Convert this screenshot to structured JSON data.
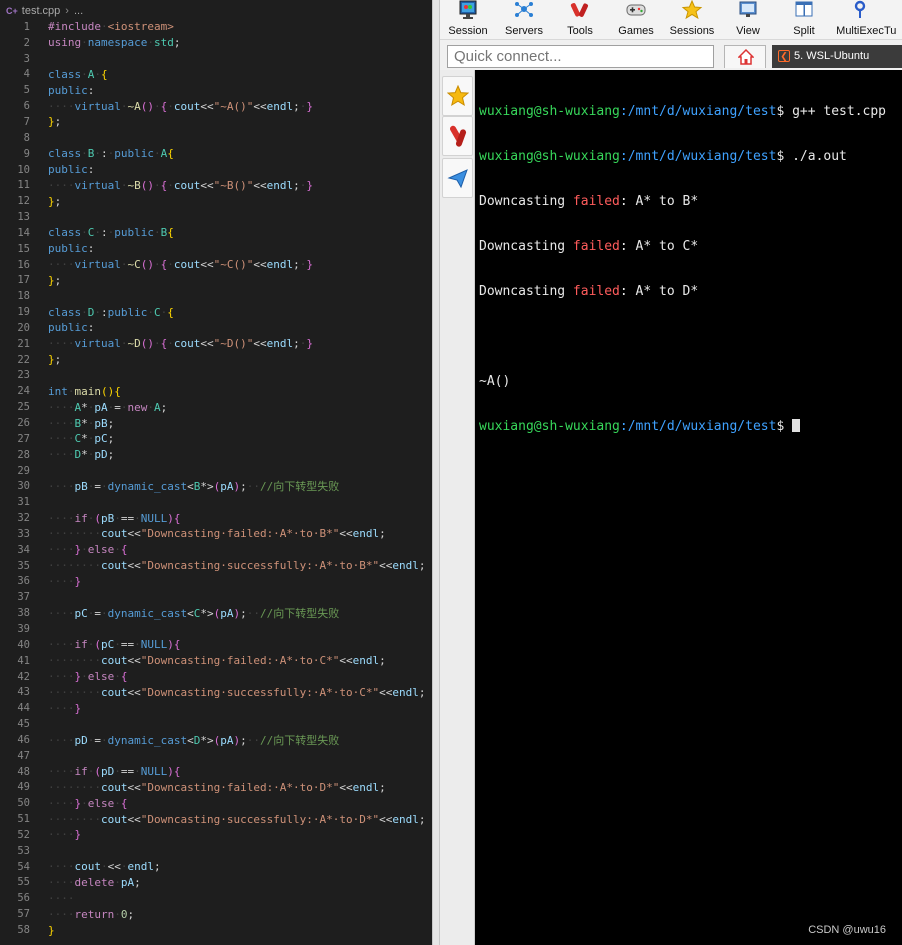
{
  "editor": {
    "breadcrumb": {
      "file_icon": "C+",
      "file": "test.cpp",
      "rest": "..."
    },
    "lines": [
      {
        "n": "1",
        "html": "<span class='pp'>#include</span><span class='ws'>·</span><span class='st'>&lt;iostream&gt;</span>"
      },
      {
        "n": "2",
        "html": "<span class='kw2'>using</span><span class='ws'>·</span><span class='kw'>namespace</span><span class='ws'>·</span><span class='ty'>std</span>;"
      },
      {
        "n": "3",
        "html": ""
      },
      {
        "n": "4",
        "html": "<span class='kw'>class</span><span class='ws'>·</span><span class='ty'>A</span><span class='ws'>·</span><span class='br'>{</span>"
      },
      {
        "n": "5",
        "html": "<span class='kw'>public</span>:"
      },
      {
        "n": "6",
        "html": "<span class='ws'>····</span><span class='kw'>virtual</span><span class='ws'>·</span><span class='fn'>~A</span><span class='br2'>()</span><span class='ws'>·</span><span class='br2'>{</span><span class='ws'>·</span><span class='va'>cout</span>&lt;&lt;<span class='st'>\"~A()\"</span>&lt;&lt;<span class='va'>endl</span>;<span class='ws'>·</span><span class='br2'>}</span>"
      },
      {
        "n": "7",
        "html": "<span class='br'>}</span>;"
      },
      {
        "n": "8",
        "html": ""
      },
      {
        "n": "9",
        "html": "<span class='kw'>class</span><span class='ws'>·</span><span class='ty'>B</span><span class='ws'>·</span>:<span class='ws'>·</span><span class='kw'>public</span><span class='ws'>·</span><span class='ty'>A</span><span class='br'>{</span>"
      },
      {
        "n": "10",
        "html": "<span class='kw'>public</span>:"
      },
      {
        "n": "11",
        "html": "<span class='ws'>····</span><span class='kw'>virtual</span><span class='ws'>·</span><span class='fn'>~B</span><span class='br2'>()</span><span class='ws'>·</span><span class='br2'>{</span><span class='ws'>·</span><span class='va'>cout</span>&lt;&lt;<span class='st'>\"~B()\"</span>&lt;&lt;<span class='va'>endl</span>;<span class='ws'>·</span><span class='br2'>}</span>"
      },
      {
        "n": "12",
        "html": "<span class='br'>}</span>;"
      },
      {
        "n": "13",
        "html": ""
      },
      {
        "n": "14",
        "html": "<span class='kw'>class</span><span class='ws'>·</span><span class='ty'>C</span><span class='ws'>·</span>:<span class='ws'>·</span><span class='kw'>public</span><span class='ws'>·</span><span class='ty'>B</span><span class='br'>{</span>"
      },
      {
        "n": "15",
        "html": "<span class='kw'>public</span>:"
      },
      {
        "n": "16",
        "html": "<span class='ws'>····</span><span class='kw'>virtual</span><span class='ws'>·</span><span class='fn'>~C</span><span class='br2'>()</span><span class='ws'>·</span><span class='br2'>{</span><span class='ws'>·</span><span class='va'>cout</span>&lt;&lt;<span class='st'>\"~C()\"</span>&lt;&lt;<span class='va'>endl</span>;<span class='ws'>·</span><span class='br2'>}</span>"
      },
      {
        "n": "17",
        "html": "<span class='br'>}</span>;"
      },
      {
        "n": "18",
        "html": ""
      },
      {
        "n": "19",
        "html": "<span class='kw'>class</span><span class='ws'>·</span><span class='ty'>D</span><span class='ws'>·</span>:<span class='kw'>public</span><span class='ws'>·</span><span class='ty'>C</span><span class='ws'>·</span><span class='br'>{</span>"
      },
      {
        "n": "20",
        "html": "<span class='kw'>public</span>:"
      },
      {
        "n": "21",
        "html": "<span class='ws'>····</span><span class='kw'>virtual</span><span class='ws'>·</span><span class='fn'>~D</span><span class='br2'>()</span><span class='ws'>·</span><span class='br2'>{</span><span class='ws'>·</span><span class='va'>cout</span>&lt;&lt;<span class='st'>\"~D()\"</span>&lt;&lt;<span class='va'>endl</span>;<span class='ws'>·</span><span class='br2'>}</span>"
      },
      {
        "n": "22",
        "html": "<span class='br'>}</span>;"
      },
      {
        "n": "23",
        "html": ""
      },
      {
        "n": "24",
        "html": "<span class='kw'>int</span><span class='ws'>·</span><span class='fn'>main</span><span class='br'>(){</span>"
      },
      {
        "n": "25",
        "html": "<span class='ws'>····</span><span class='ty'>A</span>*<span class='ws'>·</span><span class='va'>pA</span><span class='ws'>·</span>=<span class='ws'>·</span><span class='kw2'>new</span><span class='ws'>·</span><span class='ty'>A</span>;"
      },
      {
        "n": "26",
        "html": "<span class='ws'>····</span><span class='ty'>B</span>*<span class='ws'>·</span><span class='va'>pB</span>;"
      },
      {
        "n": "27",
        "html": "<span class='ws'>····</span><span class='ty'>C</span>*<span class='ws'>·</span><span class='va'>pC</span>;"
      },
      {
        "n": "28",
        "html": "<span class='ws'>····</span><span class='ty'>D</span>*<span class='ws'>·</span><span class='va'>pD</span>;"
      },
      {
        "n": "29",
        "html": ""
      },
      {
        "n": "30",
        "html": "<span class='ws'>····</span><span class='va'>pB</span><span class='ws'>·</span>=<span class='ws'>·</span><span class='kw'>dynamic_cast</span>&lt;<span class='ty'>B</span>*&gt;<span class='br2'>(</span><span class='va'>pA</span><span class='br2'>)</span>;<span class='ws'>··</span><span class='cm'>//向下转型失败</span>"
      },
      {
        "n": "31",
        "html": ""
      },
      {
        "n": "32",
        "html": "<span class='ws'>····</span><span class='kw2'>if</span><span class='ws'>·</span><span class='br2'>(</span><span class='va'>pB</span><span class='ws'>·</span>==<span class='ws'>·</span><span class='kw'>NULL</span><span class='br2'>)</span><span class='br2'>{</span>"
      },
      {
        "n": "33",
        "html": "<span class='ws'>········</span><span class='va'>cout</span>&lt;&lt;<span class='st'>\"Downcasting·failed:·A*·to·B*\"</span>&lt;&lt;<span class='va'>endl</span>;"
      },
      {
        "n": "34",
        "html": "<span class='ws'>····</span><span class='br2'>}</span><span class='ws'>·</span><span class='kw2'>else</span><span class='ws'>·</span><span class='br2'>{</span>"
      },
      {
        "n": "35",
        "html": "<span class='ws'>········</span><span class='va'>cout</span>&lt;&lt;<span class='st'>\"Downcasting·successfully:·A*·to·B*\"</span>&lt;&lt;<span class='va'>endl</span>;"
      },
      {
        "n": "36",
        "html": "<span class='ws'>····</span><span class='br2'>}</span>"
      },
      {
        "n": "37",
        "html": ""
      },
      {
        "n": "38",
        "html": "<span class='ws'>····</span><span class='va'>pC</span><span class='ws'>·</span>=<span class='ws'>·</span><span class='kw'>dynamic_cast</span>&lt;<span class='ty'>C</span>*&gt;<span class='br2'>(</span><span class='va'>pA</span><span class='br2'>)</span>;<span class='ws'>··</span><span class='cm'>//向下转型失败</span>"
      },
      {
        "n": "39",
        "html": ""
      },
      {
        "n": "40",
        "html": "<span class='ws'>····</span><span class='kw2'>if</span><span class='ws'>·</span><span class='br2'>(</span><span class='va'>pC</span><span class='ws'>·</span>==<span class='ws'>·</span><span class='kw'>NULL</span><span class='br2'>)</span><span class='br2'>{</span>"
      },
      {
        "n": "41",
        "html": "<span class='ws'>········</span><span class='va'>cout</span>&lt;&lt;<span class='st'>\"Downcasting·failed:·A*·to·C*\"</span>&lt;&lt;<span class='va'>endl</span>;"
      },
      {
        "n": "42",
        "html": "<span class='ws'>····</span><span class='br2'>}</span><span class='ws'>·</span><span class='kw2'>else</span><span class='ws'>·</span><span class='br2'>{</span>"
      },
      {
        "n": "43",
        "html": "<span class='ws'>········</span><span class='va'>cout</span>&lt;&lt;<span class='st'>\"Downcasting·successfully:·A*·to·C*\"</span>&lt;&lt;<span class='va'>endl</span>;"
      },
      {
        "n": "44",
        "html": "<span class='ws'>····</span><span class='br2'>}</span>"
      },
      {
        "n": "45",
        "html": ""
      },
      {
        "n": "46",
        "html": "<span class='ws'>····</span><span class='va'>pD</span><span class='ws'>·</span>=<span class='ws'>·</span><span class='kw'>dynamic_cast</span>&lt;<span class='ty'>D</span>*&gt;<span class='br2'>(</span><span class='va'>pA</span><span class='br2'>)</span>;<span class='ws'>··</span><span class='cm'>//向下转型失败</span>"
      },
      {
        "n": "47",
        "html": ""
      },
      {
        "n": "48",
        "html": "<span class='ws'>····</span><span class='kw2'>if</span><span class='ws'>·</span><span class='br2'>(</span><span class='va'>pD</span><span class='ws'>·</span>==<span class='ws'>·</span><span class='kw'>NULL</span><span class='br2'>)</span><span class='br2'>{</span>"
      },
      {
        "n": "49",
        "html": "<span class='ws'>········</span><span class='va'>cout</span>&lt;&lt;<span class='st'>\"Downcasting·failed:·A*·to·D*\"</span>&lt;&lt;<span class='va'>endl</span>;"
      },
      {
        "n": "50",
        "html": "<span class='ws'>····</span><span class='br2'>}</span><span class='ws'>·</span><span class='kw2'>else</span><span class='ws'>·</span><span class='br2'>{</span>"
      },
      {
        "n": "51",
        "html": "<span class='ws'>········</span><span class='va'>cout</span>&lt;&lt;<span class='st'>\"Downcasting·successfully:·A*·to·D*\"</span>&lt;&lt;<span class='va'>endl</span>;"
      },
      {
        "n": "52",
        "html": "<span class='ws'>····</span><span class='br2'>}</span>"
      },
      {
        "n": "53",
        "html": ""
      },
      {
        "n": "54",
        "html": "<span class='ws'>····</span><span class='va'>cout</span><span class='ws'>·</span>&lt;&lt;<span class='ws'>·</span><span class='va'>endl</span>;"
      },
      {
        "n": "55",
        "html": "<span class='ws'>····</span><span class='kw2'>delete</span><span class='ws'>·</span><span class='va'>pA</span>;"
      },
      {
        "n": "56",
        "html": "<span class='ws'>····</span>"
      },
      {
        "n": "57",
        "html": "<span class='ws'>····</span><span class='kw2'>return</span><span class='ws'>·</span><span class='nu'>0</span>;"
      },
      {
        "n": "58",
        "html": "<span class='br'>}</span>"
      }
    ]
  },
  "moba": {
    "toolbar": [
      {
        "id": "session",
        "label": "Session",
        "icon": "monitor-icon"
      },
      {
        "id": "servers",
        "label": "Servers",
        "icon": "servers-icon"
      },
      {
        "id": "tools",
        "label": "Tools",
        "icon": "tools-icon"
      },
      {
        "id": "games",
        "label": "Games",
        "icon": "gamepad-icon"
      },
      {
        "id": "sessions",
        "label": "Sessions",
        "icon": "star-icon"
      },
      {
        "id": "view",
        "label": "View",
        "icon": "view-icon"
      },
      {
        "id": "split",
        "label": "Split",
        "icon": "split-icon"
      },
      {
        "id": "multiexec",
        "label": "MultiExec",
        "icon": "multiexec-icon"
      },
      {
        "id": "tunneling",
        "label": "Tu",
        "icon": "tunnel-icon"
      }
    ],
    "quick_connect_placeholder": "Quick connect...",
    "session_tab": {
      "label": "5. WSL-Ubuntu"
    },
    "terminal": {
      "prompt_user": "wuxiang@sh-wuxiang",
      "prompt_path": ":/mnt/d/wuxiang/test",
      "prompt_end": "$ ",
      "cmd1": "g++ test.cpp",
      "cmd2": "./a.out",
      "out1_a": "Downcasting ",
      "out1_b": "failed",
      "out1_c": ": A* to B*",
      "out2_a": "Downcasting ",
      "out2_b": "failed",
      "out2_c": ": A* to C*",
      "out3_a": "Downcasting ",
      "out3_b": "failed",
      "out3_c": ": A* to D*",
      "out4": "~A()"
    },
    "colors": {
      "user": "#37d75a",
      "path": "#3fa2ff",
      "failed": "#ff5c5c"
    }
  },
  "watermark": "CSDN @uwu16"
}
